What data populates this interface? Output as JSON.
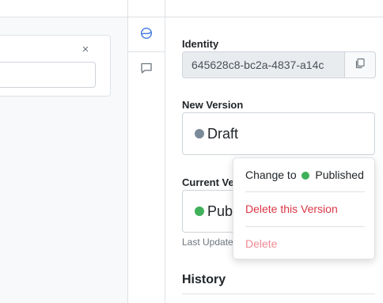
{
  "editor": {
    "close_glyph": "×"
  },
  "sidebar_rail": {
    "items": [
      {
        "icon": "revisions-icon",
        "active": true
      },
      {
        "icon": "comment-icon",
        "active": false
      }
    ]
  },
  "panel": {
    "identity_label": "Identity",
    "identity_value": "645628c8-bc2a-4837-a14c",
    "new_version_label": "New Version",
    "new_version_status": "Draft",
    "current_version_label": "Current Version",
    "current_version_status": "Published",
    "last_updated_label": "Last Updated",
    "history_title": "History"
  },
  "dropdown": {
    "change_prefix": "Change to",
    "change_target": "Published",
    "delete_version": "Delete this Version",
    "delete": "Delete"
  },
  "colors": {
    "draft_dot": "#7a8a99",
    "published_dot": "#3fb15a",
    "danger": "#dc3545",
    "danger_muted": "#f08a94"
  }
}
